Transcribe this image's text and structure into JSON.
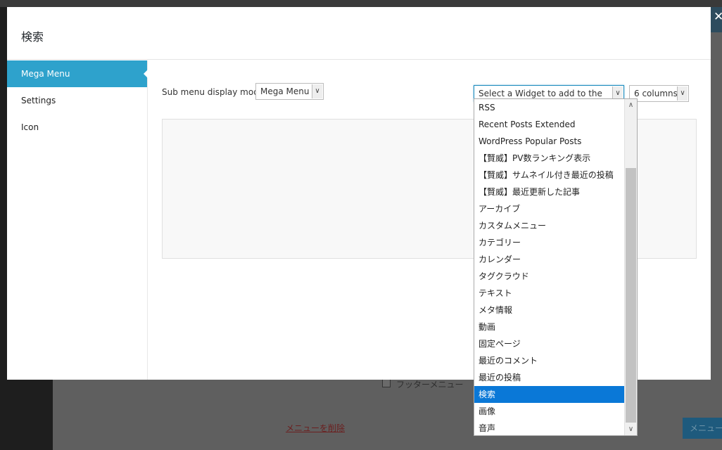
{
  "modal": {
    "title": "検索",
    "close_icon": "close-icon",
    "nav": [
      {
        "label": "Mega Menu",
        "active": true
      },
      {
        "label": "Settings",
        "active": false
      },
      {
        "label": "Icon",
        "active": false
      }
    ]
  },
  "content": {
    "submenu_label": "Sub menu display mode",
    "submenu_value": "Mega Menu",
    "widget_select_value": "Select a Widget to add to the panel",
    "columns_value": "6 columns"
  },
  "dropdown": {
    "items": [
      "RSS",
      "Recent Posts Extended",
      "WordPress Popular Posts",
      "【賢威】PV数ランキング表示",
      "【賢威】サムネイル付き最近の投稿",
      "【賢威】最近更新した記事",
      "アーカイブ",
      "カスタムメニュー",
      "カテゴリー",
      "カレンダー",
      "タグクラウド",
      "テキスト",
      "メタ情報",
      "動画",
      "固定ページ",
      "最近のコメント",
      "最近の投稿",
      "検索",
      "画像",
      "音声"
    ],
    "selected": "検索"
  },
  "background": {
    "footer_label": "フッターメニュー",
    "delete_link": "メニューを削除",
    "save_button": "メニュー"
  },
  "colors": {
    "accent": "#2ea2cc",
    "selected_item": "#0a78d7"
  }
}
